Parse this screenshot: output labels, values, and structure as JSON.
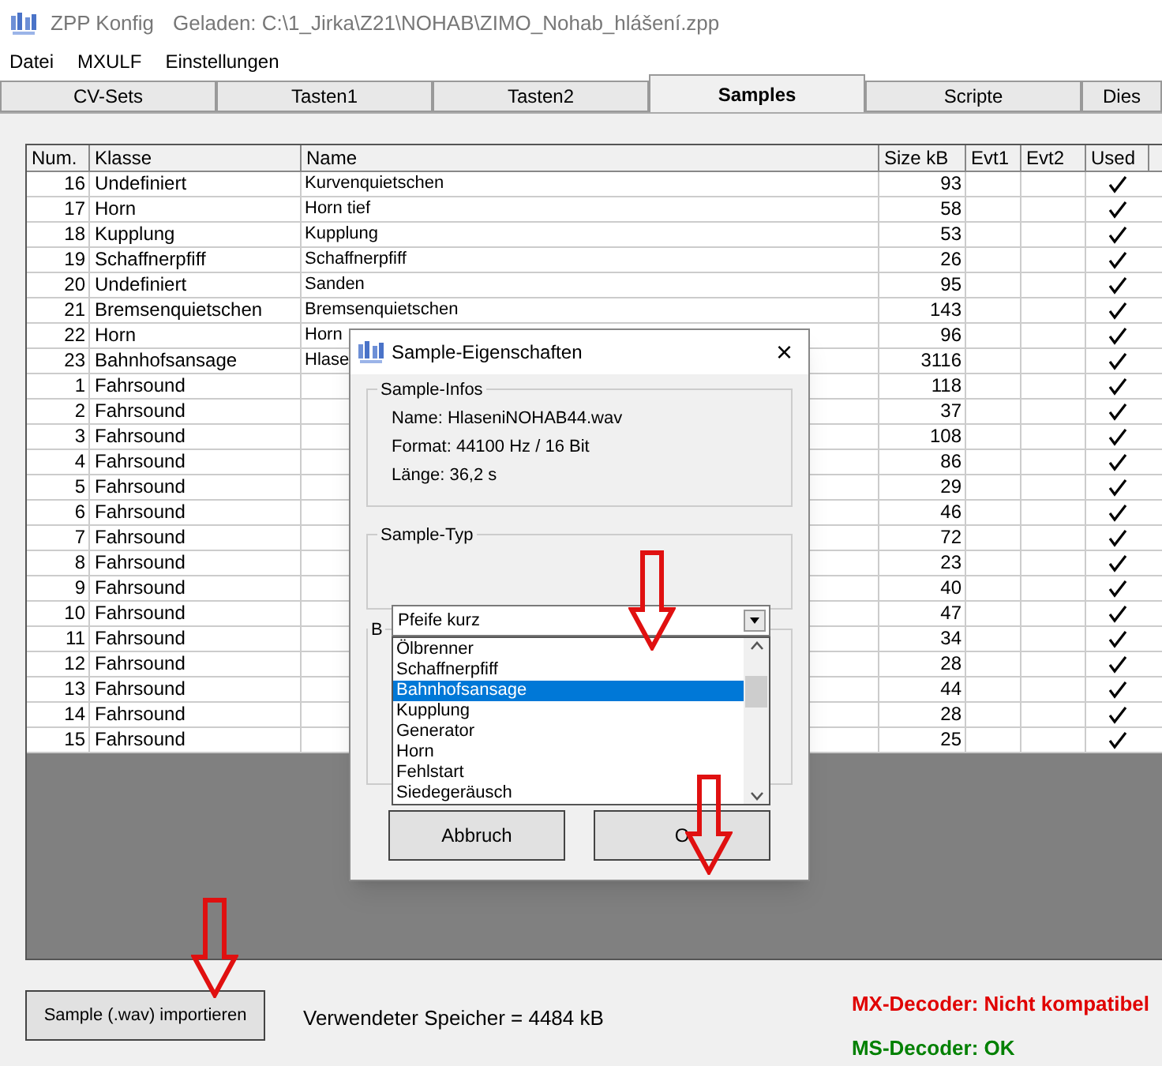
{
  "window": {
    "title": "ZPP Konfig",
    "loaded": "Geladen: C:\\1_Jirka\\Z21\\NOHAB\\ZIMO_Nohab_hlášení.zpp"
  },
  "menu": [
    "Datei",
    "MXULF",
    "Einstellungen"
  ],
  "tabs": [
    {
      "label": "CV-Sets",
      "selected": false
    },
    {
      "label": "Tasten1",
      "selected": false
    },
    {
      "label": "Tasten2",
      "selected": false
    },
    {
      "label": "Samples",
      "selected": true
    },
    {
      "label": "Scripte",
      "selected": false
    },
    {
      "label": "Dies",
      "selected": false
    }
  ],
  "table": {
    "columns": [
      "Num.",
      "Klasse",
      "Name",
      "Size kB",
      "Evt1",
      "Evt2",
      "Used"
    ],
    "rows": [
      {
        "num": "16",
        "klasse": "Undefiniert",
        "name": "Kurvenquietschen",
        "size": "93",
        "used": true
      },
      {
        "num": "17",
        "klasse": "Horn",
        "name": "Horn tief",
        "size": "58",
        "used": true
      },
      {
        "num": "18",
        "klasse": "Kupplung",
        "name": "Kupplung",
        "size": "53",
        "used": true
      },
      {
        "num": "19",
        "klasse": "Schaffnerpfiff",
        "name": "Schaffnerpfiff",
        "size": "26",
        "used": true
      },
      {
        "num": "20",
        "klasse": "Undefiniert",
        "name": "Sanden",
        "size": "95",
        "used": true
      },
      {
        "num": "21",
        "klasse": "Bremsenquietschen",
        "name": "Bremsenquietschen",
        "size": "143",
        "used": true
      },
      {
        "num": "22",
        "klasse": "Horn",
        "name": "Horn",
        "size": "96",
        "used": true
      },
      {
        "num": "23",
        "klasse": "Bahnhofsansage",
        "name": "Hlase",
        "size": "3116",
        "used": true
      },
      {
        "num": "1",
        "klasse": "Fahrsound",
        "size": "118",
        "used": true
      },
      {
        "num": "2",
        "klasse": "Fahrsound",
        "size": "37",
        "used": true
      },
      {
        "num": "3",
        "klasse": "Fahrsound",
        "size": "108",
        "used": true
      },
      {
        "num": "4",
        "klasse": "Fahrsound",
        "size": "86",
        "used": true
      },
      {
        "num": "5",
        "klasse": "Fahrsound",
        "size": "29",
        "used": true
      },
      {
        "num": "6",
        "klasse": "Fahrsound",
        "size": "46",
        "used": true
      },
      {
        "num": "7",
        "klasse": "Fahrsound",
        "size": "72",
        "used": true
      },
      {
        "num": "8",
        "klasse": "Fahrsound",
        "size": "23",
        "used": true
      },
      {
        "num": "9",
        "klasse": "Fahrsound",
        "size": "40",
        "used": true
      },
      {
        "num": "10",
        "klasse": "Fahrsound",
        "size": "47",
        "used": true
      },
      {
        "num": "11",
        "klasse": "Fahrsound",
        "size": "34",
        "used": true
      },
      {
        "num": "12",
        "klasse": "Fahrsound",
        "size": "28",
        "used": true
      },
      {
        "num": "13",
        "klasse": "Fahrsound",
        "size": "44",
        "used": true
      },
      {
        "num": "14",
        "klasse": "Fahrsound",
        "size": "28",
        "used": true
      },
      {
        "num": "15",
        "klasse": "Fahrsound",
        "size": "25",
        "used": true
      }
    ]
  },
  "import_button": "Sample (.wav) importieren",
  "memory": "Verwendeter Speicher = 4484 kB",
  "decoder_status": [
    {
      "text": "MX-Decoder: Nicht kompatibel",
      "color": "#e00000"
    },
    {
      "text": "MS-Decoder: OK",
      "color": "#008000"
    }
  ],
  "dialog": {
    "title": "Sample-Eigenschaften",
    "close": "×",
    "infos_group": "Sample-Infos",
    "infos": [
      "Name: HlaseniNOHAB44.wav",
      "Format: 44100 Hz / 16 Bit",
      "Länge: 36,2 s"
    ],
    "type_group": "Sample-Typ",
    "type_value": "Pfeife kurz",
    "third_group": "B",
    "options": [
      {
        "label": "Ölbrenner",
        "selected": false
      },
      {
        "label": "Schaffnerpfiff",
        "selected": false
      },
      {
        "label": "Bahnhofsansage",
        "selected": true
      },
      {
        "label": "Kupplung",
        "selected": false
      },
      {
        "label": "Generator",
        "selected": false
      },
      {
        "label": "Horn",
        "selected": false
      },
      {
        "label": "Fehlstart",
        "selected": false
      },
      {
        "label": "Siedegeräusch",
        "selected": false
      }
    ],
    "buttons": [
      "Abbruch",
      "O"
    ]
  }
}
